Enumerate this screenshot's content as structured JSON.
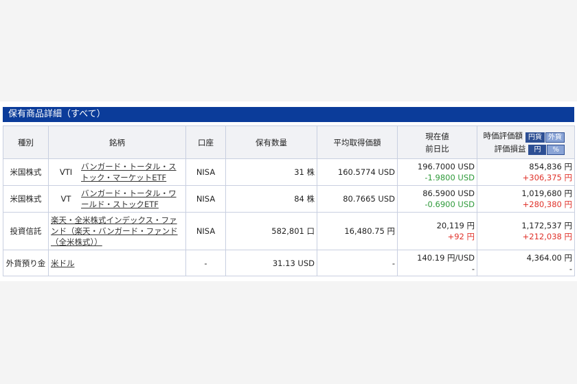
{
  "section_title": "保有商品詳細（すべて）",
  "headers": {
    "type": "種別",
    "name": "銘柄",
    "account": "口座",
    "qty": "保有数量",
    "avg_cost": "平均取得価額",
    "price_line1": "現在値",
    "price_line2": "前日比",
    "value_line1": "時価評価額",
    "value_line2": "評価損益",
    "toggle_value_a": "円貨",
    "toggle_value_b": "外貨",
    "toggle_pl_a": "円",
    "toggle_pl_b": "%"
  },
  "rows": [
    {
      "type": "米国株式",
      "ticker": "VTI",
      "name": "バンガード・トータル・ストック・マーケットETF",
      "account": "NISA",
      "qty": "31 株",
      "avg_cost": "160.5774 USD",
      "price": "196.7000 USD",
      "change": "-1.9800 USD",
      "value": "854,836 円",
      "pl": "+306,375 円"
    },
    {
      "type": "米国株式",
      "ticker": "VT",
      "name": "バンガード・トータル・ワールド・ストックETF",
      "account": "NISA",
      "qty": "84 株",
      "avg_cost": "80.7665 USD",
      "price": "86.5900 USD",
      "change": "-0.6900 USD",
      "value": "1,019,680 円",
      "pl": "+280,380 円"
    },
    {
      "type": "投資信託",
      "ticker": "",
      "name": "楽天・全米株式インデックス・ファンド（楽天・バンガード・ファンド（全米株式））",
      "account": "NISA",
      "qty": "582,801 口",
      "avg_cost": "16,480.75 円",
      "price": "20,119 円",
      "change": "+92 円",
      "value": "1,172,537 円",
      "pl": "+212,038 円"
    },
    {
      "type": "外貨預り金",
      "ticker": "",
      "name": "米ドル",
      "account": "-",
      "qty": "31.13 USD",
      "avg_cost": "-",
      "price": "140.19 円/USD",
      "change": "-",
      "value": "4,364.00 円",
      "pl": "-"
    }
  ]
}
